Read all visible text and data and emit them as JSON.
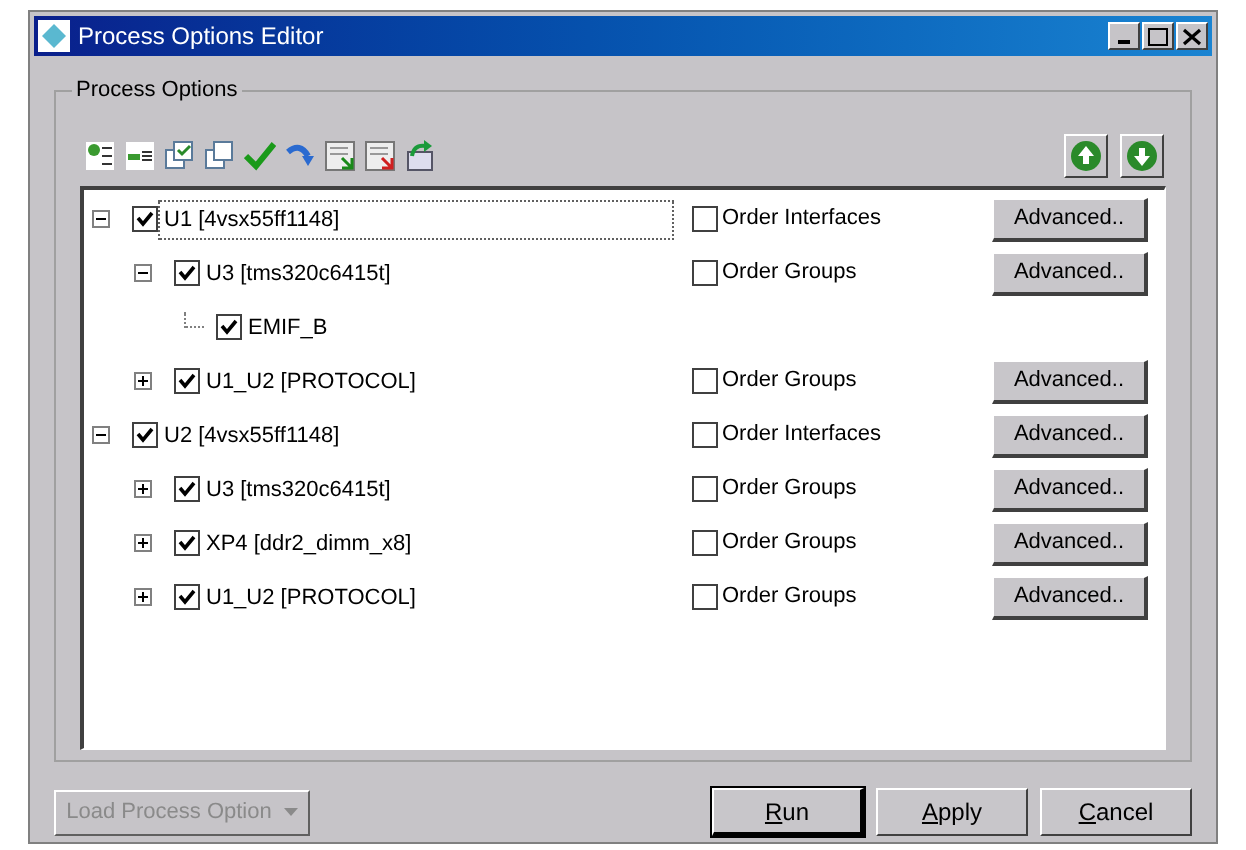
{
  "window": {
    "title": "Process Options Editor"
  },
  "group": {
    "title": "Process Options"
  },
  "tree": [
    {
      "label": "U1 [4vsx55ff1148]",
      "checked": true,
      "expanded": true,
      "selected": true,
      "option": {
        "label": "Order Interfaces",
        "checked": false
      },
      "button": "Advanced..",
      "children": [
        {
          "label": "U3 [tms320c6415t]",
          "checked": true,
          "expanded": true,
          "selected": false,
          "option": {
            "label": "Order Groups",
            "checked": false
          },
          "button": "Advanced..",
          "children": [
            {
              "label": "EMIF_B",
              "checked": true,
              "selected": false
            }
          ]
        },
        {
          "label": "U1_U2 [PROTOCOL]",
          "checked": true,
          "expanded": false,
          "selected": false,
          "option": {
            "label": "Order Groups",
            "checked": false
          },
          "button": "Advanced.."
        }
      ]
    },
    {
      "label": "U2 [4vsx55ff1148]",
      "checked": true,
      "expanded": true,
      "selected": false,
      "option": {
        "label": "Order Interfaces",
        "checked": false
      },
      "button": "Advanced..",
      "children": [
        {
          "label": "U3 [tms320c6415t]",
          "checked": true,
          "expanded": false,
          "selected": false,
          "option": {
            "label": "Order Groups",
            "checked": false
          },
          "button": "Advanced.."
        },
        {
          "label": "XP4 [ddr2_dimm_x8]",
          "checked": true,
          "expanded": false,
          "selected": false,
          "option": {
            "label": "Order Groups",
            "checked": false
          },
          "button": "Advanced.."
        },
        {
          "label": "U1_U2 [PROTOCOL]",
          "checked": true,
          "expanded": false,
          "selected": false,
          "option": {
            "label": "Order Groups",
            "checked": false
          },
          "button": "Advanced.."
        }
      ]
    }
  ],
  "footer": {
    "load_button": {
      "label": "Load Process Option",
      "disabled": true
    },
    "buttons": [
      {
        "label": "Run",
        "default": true
      },
      {
        "label": "Apply",
        "default": false
      },
      {
        "label": "Cancel",
        "default": false
      }
    ]
  }
}
